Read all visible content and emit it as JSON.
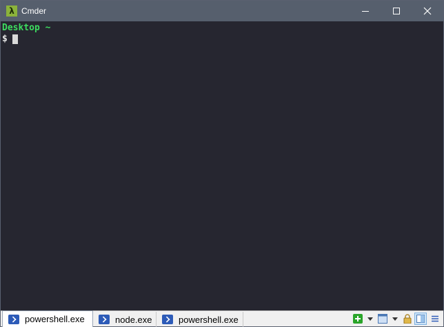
{
  "window": {
    "title": "Cmder",
    "app_icon_glyph": "λ",
    "buttons": [
      "minimize-icon",
      "maximize-icon",
      "close-icon"
    ]
  },
  "terminal": {
    "path_line": "Desktop ~",
    "prompt_symbol": "$"
  },
  "tabs": [
    {
      "label": "powershell.exe",
      "active": true
    },
    {
      "label": "node.exe",
      "active": false
    },
    {
      "label": "powershell.exe",
      "active": false
    }
  ],
  "toolbar_icons": [
    "add-console-icon",
    "dropdown-icon",
    "split-view-icon",
    "dropdown-icon",
    "lock-icon",
    "layout-icon",
    "menu-icon"
  ],
  "colors": {
    "titlebar": "#565f6d",
    "terminal_bg": "#262630",
    "prompt_green": "#3ddb5f",
    "tabbar_bg": "#f0f0f0"
  }
}
